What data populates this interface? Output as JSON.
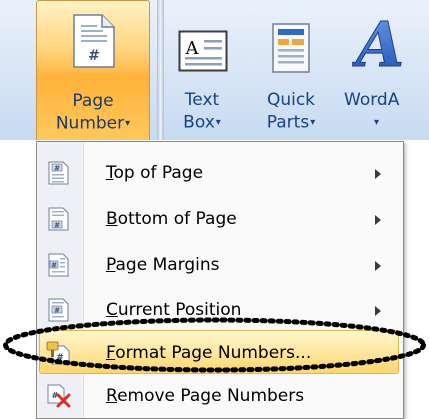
{
  "ribbon": {
    "page_number": {
      "line1": "Page",
      "line2": "Number",
      "arrow": "▾"
    },
    "text_box": {
      "line1": "Text",
      "line2": "Box",
      "arrow": "▾"
    },
    "quick_parts": {
      "line1": "Quick",
      "line2": "Parts",
      "arrow": "▾"
    },
    "wordart": {
      "line1": "WordA",
      "arrow": "▾"
    }
  },
  "menu": {
    "items": [
      {
        "label": "Top of Page",
        "icon": "page-top-icon",
        "has_submenu": true
      },
      {
        "label": "Bottom of Page",
        "icon": "page-bottom-icon",
        "has_submenu": true
      },
      {
        "label": "Page Margins",
        "icon": "page-margins-icon",
        "has_submenu": true
      },
      {
        "label": "Current Position",
        "icon": "current-position-icon",
        "has_submenu": true
      },
      {
        "label": "Format Page Numbers...",
        "icon": "format-page-numbers-icon",
        "has_submenu": false,
        "highlighted": true
      },
      {
        "label": "Remove Page Numbers",
        "icon": "remove-page-numbers-icon",
        "has_submenu": false
      }
    ]
  },
  "colors": {
    "ribbon_label": "#15428b",
    "highlight": "#ffe59a",
    "remove_x": "#d9302b"
  }
}
